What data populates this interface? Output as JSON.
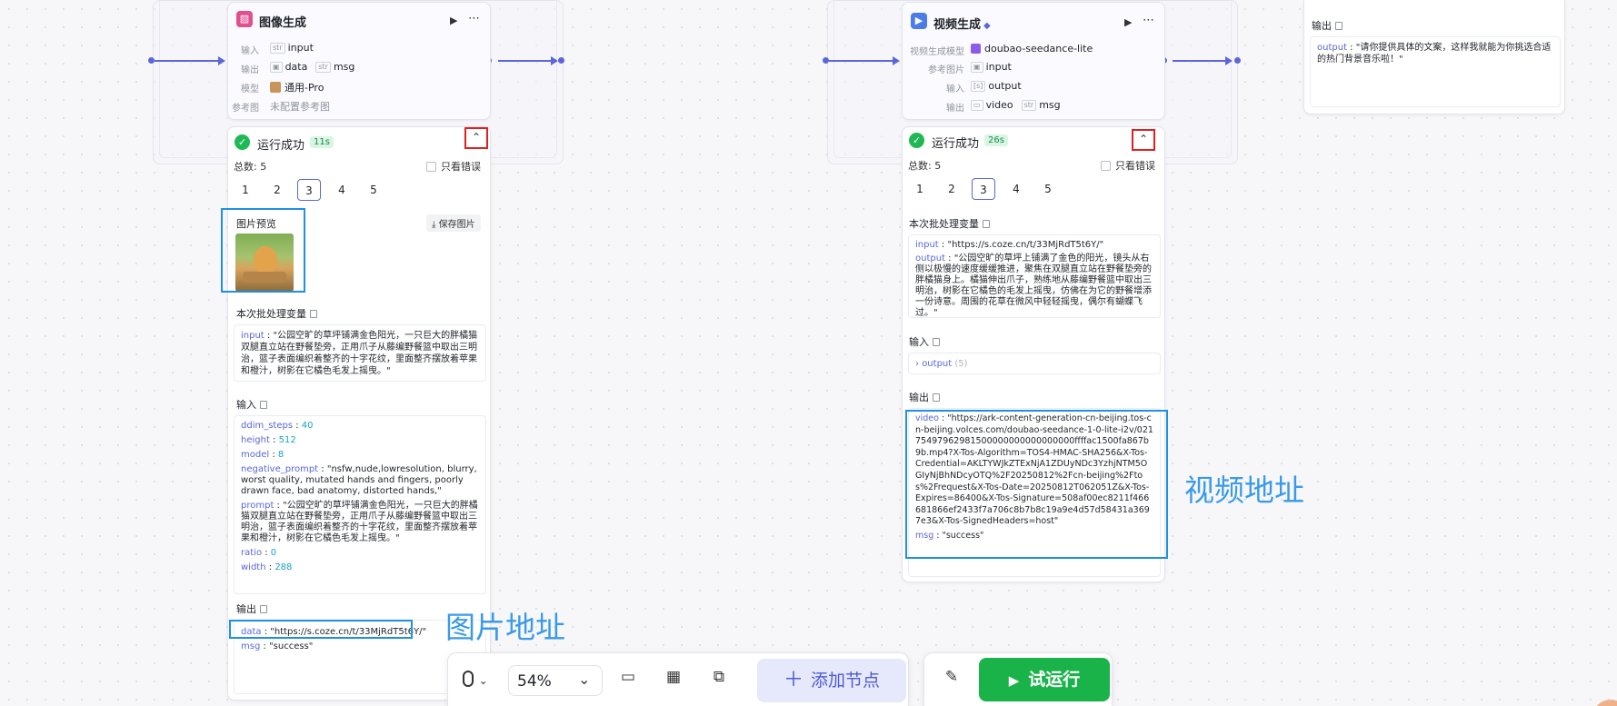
{
  "left_node": {
    "title": "图像生成",
    "rows": [
      {
        "label": "输入",
        "tags": [
          {
            "type": "str",
            "name": "input"
          }
        ]
      },
      {
        "label": "输出",
        "tags": [
          {
            "type": "img",
            "name": "data"
          },
          {
            "type": "str",
            "name": "msg"
          }
        ]
      },
      {
        "label": "模型",
        "value": "通用-Pro"
      },
      {
        "label": "参考图",
        "value": "未配置参考图"
      }
    ],
    "status": "运行成功",
    "duration": "11s",
    "total": "总数: 5",
    "only_errors": "只看错误",
    "pages": [
      "1",
      "2",
      "3",
      "4",
      "5"
    ],
    "active_page": "3",
    "image_preview": "图片预览",
    "save_image": "保存图片",
    "batch_title": "本次批处理变量",
    "batch": {
      "key": "input",
      "value": "\"公园空旷的草坪铺满金色阳光，一只巨大的胖橘猫双腿直立站在野餐垫旁，正用爪子从藤编野餐篮中取出三明治，篮子表面编织着整齐的十字花纹，里面整齐摆放着苹果和橙汁，树影在它橘色毛发上摇曳。\""
    },
    "input_title": "输入",
    "inputs": [
      {
        "key": "ddim_steps",
        "value": "40",
        "num": true
      },
      {
        "key": "height",
        "value": "512",
        "num": true
      },
      {
        "key": "model",
        "value": "8",
        "num": true
      },
      {
        "key": "negative_prompt",
        "value": "\"nsfw,nude,lowresolution, blurry, worst quality, mutated hands and fingers, poorly drawn face, bad anatomy, distorted hands,\"",
        "num": false
      },
      {
        "key": "prompt",
        "value": "\"公园空旷的草坪铺满金色阳光，一只巨大的胖橘猫双腿直立站在野餐垫旁，正用爪子从藤编野餐篮中取出三明治，篮子表面编织着整齐的十字花纹，里面整齐摆放着苹果和橙汁，树影在它橘色毛发上摇曳。\"",
        "num": false
      },
      {
        "key": "ratio",
        "value": "0",
        "num": true
      },
      {
        "key": "width",
        "value": "288",
        "num": true
      }
    ],
    "output_title": "输出",
    "outputs": [
      {
        "key": "data",
        "value": "\"https://s.coze.cn/t/33MjRdT5t6Y/\""
      },
      {
        "key": "msg",
        "value": "\"success\""
      }
    ]
  },
  "right_node": {
    "title": "视频生成",
    "rows": [
      {
        "label": "视频生成模型",
        "value": "doubao-seedance-lite"
      },
      {
        "label": "参考图片",
        "tags": [
          {
            "type": "img",
            "name": "input"
          }
        ]
      },
      {
        "label": "输入",
        "tags": [
          {
            "type": "list",
            "name": "output"
          }
        ]
      },
      {
        "label": "输出",
        "tags": [
          {
            "type": "folder",
            "name": "video"
          },
          {
            "type": "str",
            "name": "msg"
          }
        ]
      }
    ],
    "status": "运行成功",
    "duration": "26s",
    "total": "总数: 5",
    "only_errors": "只看错误",
    "pages": [
      "1",
      "2",
      "3",
      "4",
      "5"
    ],
    "active_page": "3",
    "batch_title": "本次批处理变量",
    "batch": [
      {
        "key": "input",
        "value": "\"https://s.coze.cn/t/33MjRdT5t6Y/\""
      },
      {
        "key": "output",
        "value": "\"公园空旷的草坪上铺满了金色的阳光，镜头从右侧以极慢的速度缓缓推进，聚焦在双腿直立站在野餐垫旁的胖橘猫身上。橘猫伸出爪子，熟练地从藤编野餐篮中取出三明治，树影在它橘色的毛发上摇曳，仿佛在为它的野餐增添一份诗意。周围的花草在微风中轻轻摇曳，偶尔有蝴蝶飞过。\""
      }
    ],
    "input_title": "输入",
    "input_collapsed": {
      "key": "output",
      "count": "(5)"
    },
    "output_title": "输出",
    "outputs": [
      {
        "key": "video",
        "value": "\"https://ark-content-generation-cn-beijing.tos-cn-beijing.volces.com/doubao-seedance-1-0-lite-i2v/02175497962981500000000000000000ffffac1500fa867b9b.mp4?X-Tos-Algorithm=TOS4-HMAC-SHA256&X-Tos-Credential=AKLTYWJkZTExNjA1ZDUyNDc3YzhjNTM5OGIyNjBhNDcyOTQ%2F20250812%2Fcn-beijing%2Ftos%2Frequest&X-Tos-Date=20250812T062051Z&X-Tos-Expires=86400&X-Tos-Signature=508af00ec8211f466681866ef2433f7a706c8b7b8c19a9e4d57d58431a3697e3&X-Tos-SignedHeaders=host\""
      },
      {
        "key": "msg",
        "value": "\"success\""
      }
    ]
  },
  "far_right": {
    "output_title": "输出",
    "output": {
      "key": "output",
      "value": "\"请你提供具体的文案，这样我就能为你挑选合适的热门背景音乐啦！\""
    }
  },
  "annotations": {
    "image_url": "图片地址",
    "video_url": "视频地址"
  },
  "toolbar": {
    "zoom": "54%",
    "add_node": "添加节点",
    "test_run": "试运行"
  },
  "colors": {
    "accent": "#5a67d8",
    "success": "#1eb954",
    "run_button": "#19b34a",
    "highlight_red": "#e02020",
    "highlight_blue": "#1f8fe6"
  }
}
